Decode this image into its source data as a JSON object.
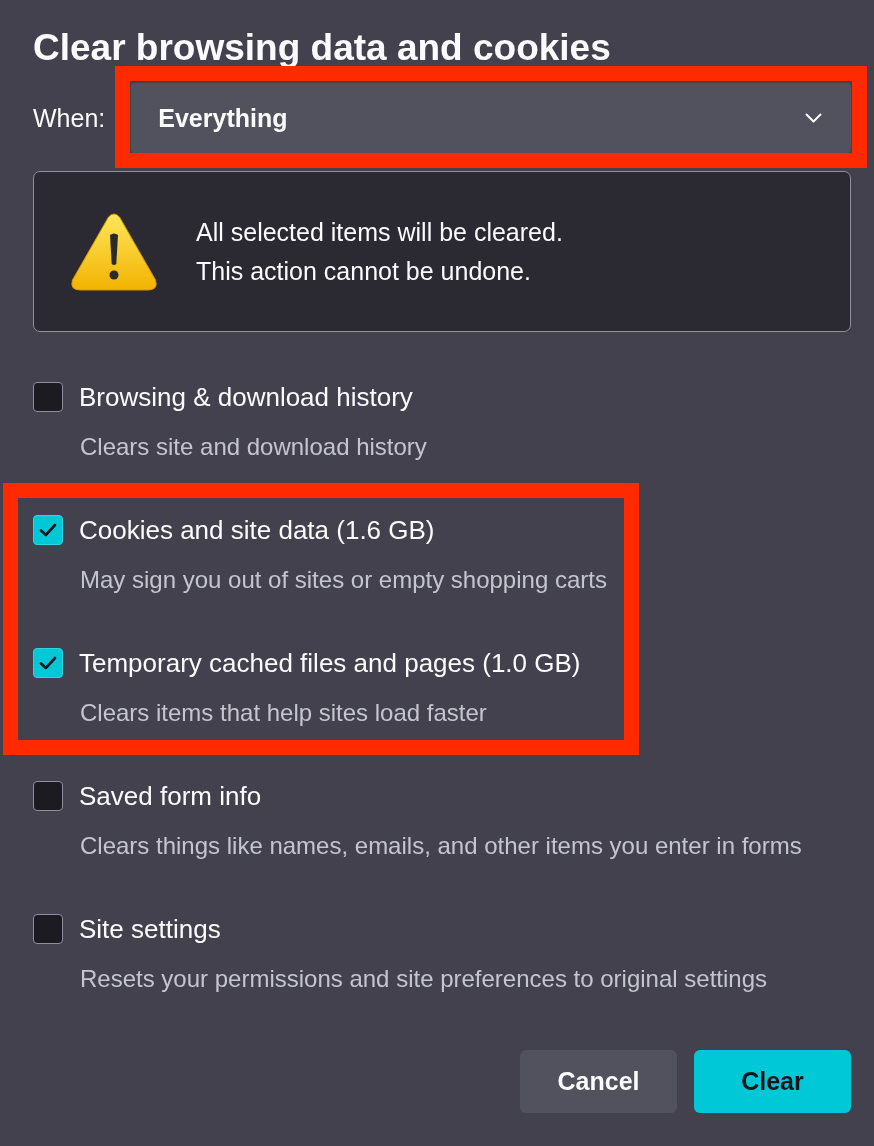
{
  "dialog": {
    "title": "Clear browsing data and cookies"
  },
  "when": {
    "label": "When:",
    "value": "Everything",
    "highlighted": true
  },
  "warning": {
    "lines": [
      "All selected items will be cleared.",
      "This action cannot be undone."
    ]
  },
  "options": [
    {
      "label": "Browsing & download history",
      "description": "Clears site and download history",
      "checked": false,
      "highlighted": false
    },
    {
      "label": "Cookies and site data (1.6 GB)",
      "description": "May sign you out of sites or empty shopping carts",
      "checked": true,
      "highlighted": true
    },
    {
      "label": "Temporary cached files and pages (1.0 GB)",
      "description": "Clears items that help sites load faster",
      "checked": true,
      "highlighted": true
    },
    {
      "label": "Saved form info",
      "description": "Clears things like names, emails, and other items you enter in forms",
      "checked": false,
      "highlighted": false
    },
    {
      "label": "Site settings",
      "description": "Resets your permissions and site preferences to original settings",
      "checked": false,
      "highlighted": false
    }
  ],
  "buttons": [
    {
      "label": "Cancel",
      "kind": "secondary"
    },
    {
      "label": "Clear",
      "kind": "primary"
    }
  ]
}
